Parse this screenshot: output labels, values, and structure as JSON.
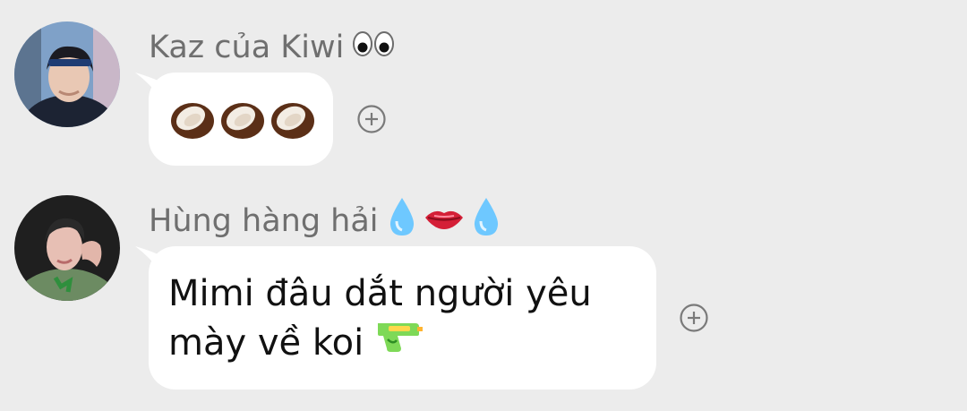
{
  "messages": [
    {
      "sender": "Kaz của Kiwi",
      "sender_emoji": "eyes",
      "text": "",
      "content_emoji": [
        "coconut",
        "coconut",
        "coconut"
      ]
    },
    {
      "sender": "Hùng hàng hải",
      "sender_emoji": [
        "droplet",
        "lips",
        "droplet"
      ],
      "text_line1": "Mimi đâu dắt người yêu",
      "text_line2": "mày về koi",
      "trailing_emoji": "water-pistol"
    }
  ],
  "colors": {
    "background": "#ececec",
    "bubble": "#ffffff",
    "sender_text": "#6f6f6f",
    "message_text": "#111111",
    "icon": "#7a7a7a"
  }
}
